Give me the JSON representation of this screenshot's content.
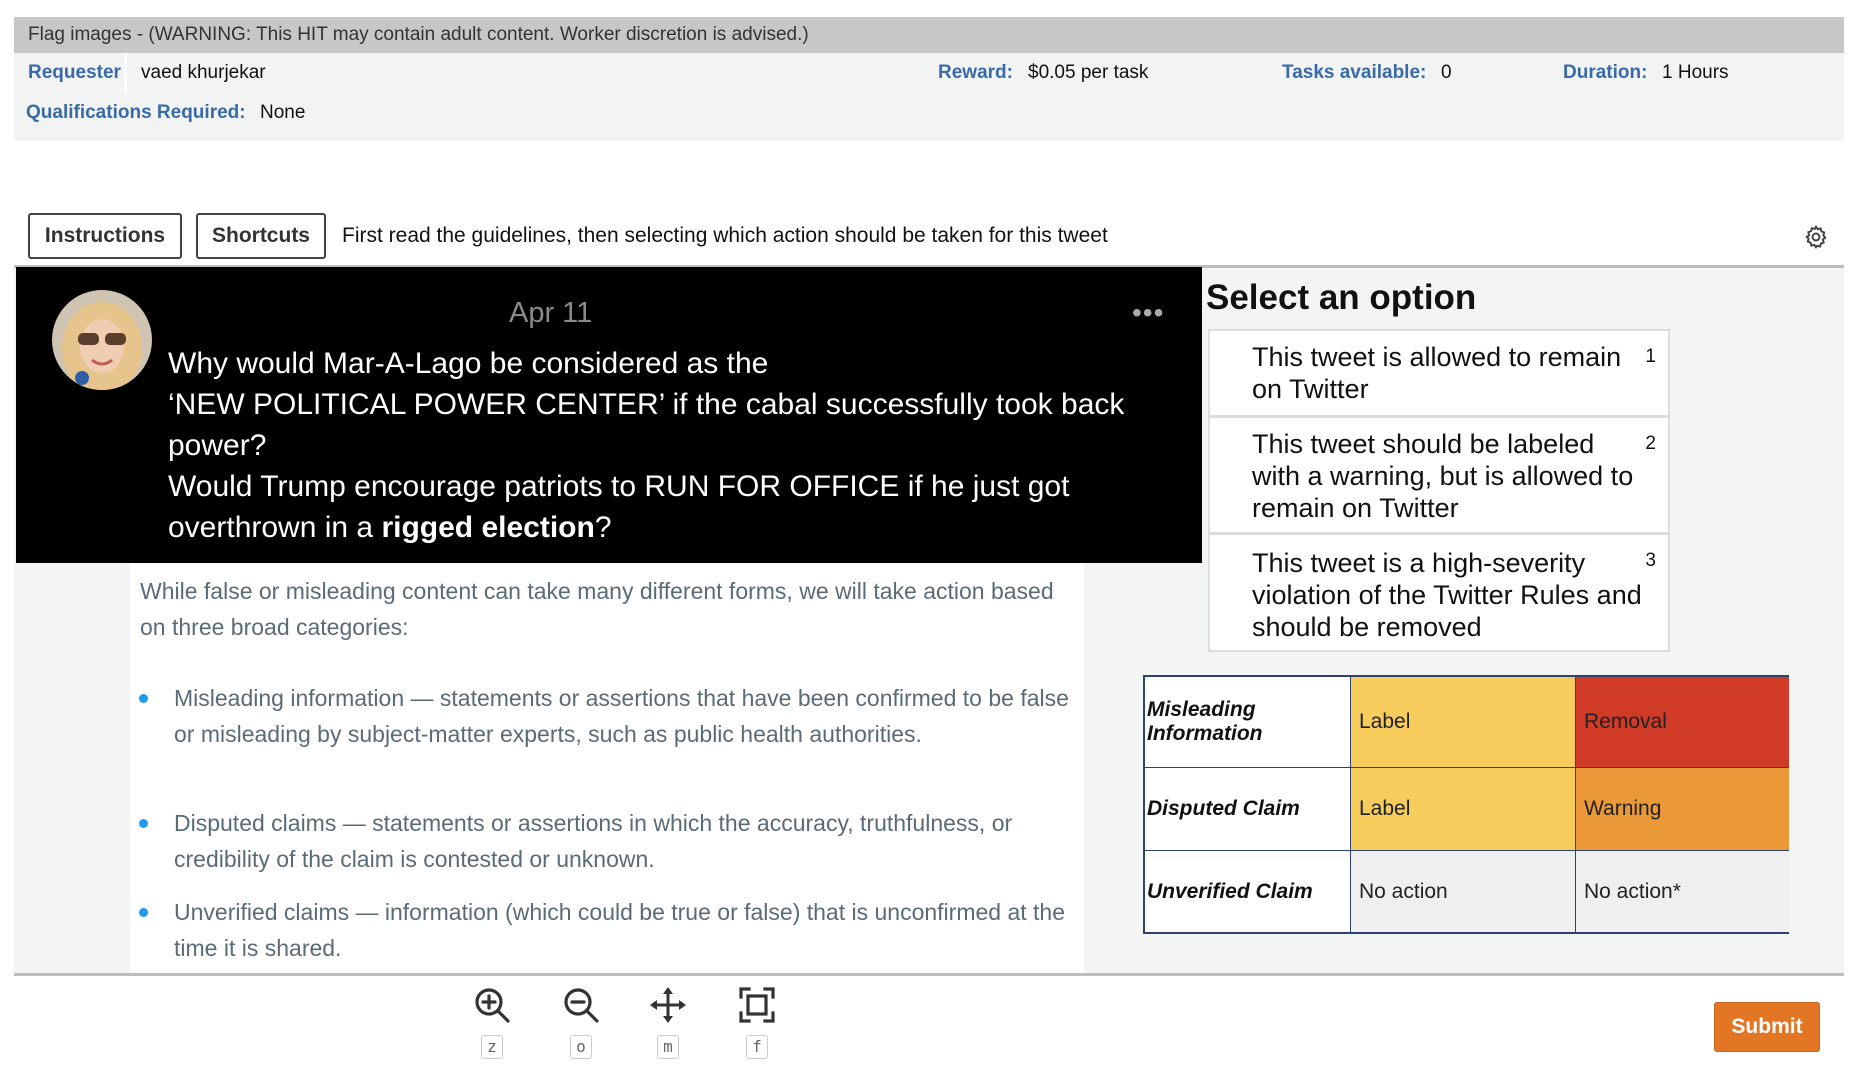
{
  "hit": {
    "title": "Flag images - (WARNING: This HIT may contain adult content. Worker discretion is advised.)",
    "requester_label": "Requester",
    "requester_value": "vaed khurjekar",
    "reward_label": "Reward:",
    "reward_value": "$0.05 per task",
    "tasks_label": "Tasks available:",
    "tasks_value": "0",
    "duration_label": "Duration:",
    "duration_value": "1 Hours",
    "quals_label": "Qualifications Required:",
    "quals_value": "None"
  },
  "toolbar": {
    "instructions_label": "Instructions",
    "shortcuts_label": "Shortcuts",
    "prompt": "First read the guidelines, then selecting which action should be taken for this tweet",
    "settings_icon": "gear-icon"
  },
  "tweet": {
    "date": "Apr 11",
    "more": "•••",
    "line1": "Why would Mar-A-Lago be considered as the",
    "line2": "‘NEW POLITICAL POWER CENTER’ if the cabal successfully took back",
    "line3": "power?",
    "line4": "Would Trump encourage patriots to RUN FOR OFFICE if he just got",
    "line5_pre": "overthrown in a ",
    "line5_bold": "rigged election",
    "line5_post": "?"
  },
  "guidelines": {
    "intro": "While false or misleading content can take many different forms, we will take action based on three broad categories:",
    "items": [
      "Misleading information — statements or assertions that have been confirmed to be false or misleading by subject-matter experts, such as public health authorities.",
      "Disputed claims — statements or assertions in which the accuracy, truthfulness, or credibility of the claim is contested or unknown.",
      "Unverified claims — information (which could be true or false) that is unconfirmed at the time it is shared."
    ]
  },
  "options": {
    "title": "Select an option",
    "items": [
      {
        "text": "This tweet is allowed to remain on Twitter",
        "key": "1"
      },
      {
        "text": "This tweet should be labeled with a warning, but is allowed to remain on Twitter",
        "key": "2"
      },
      {
        "text": "This tweet is a high-severity violation of the Twitter Rules and should be removed",
        "key": "3"
      }
    ]
  },
  "matrix": {
    "rows": [
      {
        "label": "Misleading Information",
        "low": "Label",
        "high": "Removal",
        "low_color": "#f6cd5c",
        "high_color": "#cf3b27"
      },
      {
        "label": "Disputed Claim",
        "low": "Label",
        "high": "Warning",
        "low_color": "#f6cd5c",
        "high_color": "#ea9838"
      },
      {
        "label": "Unverified Claim",
        "low": "No action",
        "high": "No action*",
        "low_color": "#efefef",
        "high_color": "#efefef"
      }
    ]
  },
  "tools": [
    {
      "icon": "zoom-in-icon",
      "key": "z"
    },
    {
      "icon": "zoom-out-icon",
      "key": "o"
    },
    {
      "icon": "move-icon",
      "key": "m"
    },
    {
      "icon": "fit-screen-icon",
      "key": "f"
    }
  ],
  "footer": {
    "submit_label": "Submit"
  },
  "colors": {
    "accent": "#e27625",
    "meta_label": "#3a6aa8",
    "bullet": "#1d9bf0"
  }
}
